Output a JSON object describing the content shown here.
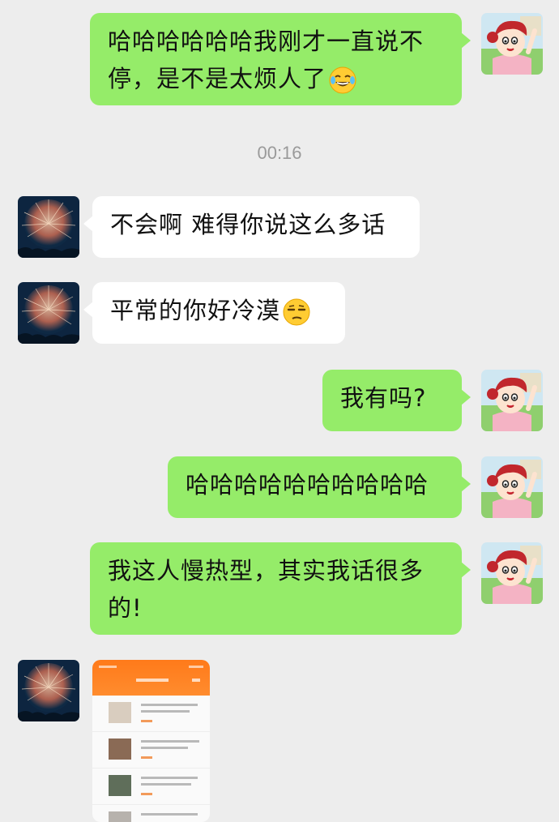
{
  "chat": {
    "timestamp": "00:16",
    "messages": [
      {
        "sender": "me",
        "text": "哈哈哈哈哈哈我刚才一直说不停，是不是太烦人了",
        "emoji": "tears-of-joy-emoji"
      },
      {
        "sender": "other",
        "text": "不会啊 难得你说这么多话"
      },
      {
        "sender": "other",
        "text": "平常的你好冷漠",
        "emoji": "unamused-face-emoji"
      },
      {
        "sender": "me",
        "text": "我有吗?"
      },
      {
        "sender": "me",
        "text": "哈哈哈哈哈哈哈哈哈哈"
      },
      {
        "sender": "me",
        "text": "我这人慢热型，其实我话很多的!"
      },
      {
        "sender": "other",
        "type": "image",
        "image": "app-screenshot-thumbnail"
      }
    ]
  },
  "avatars": {
    "me": "cartoon-girl-avatar",
    "other": "fireworks-avatar"
  },
  "colors": {
    "background": "#ededed",
    "my_bubble": "#95ec69",
    "their_bubble": "#ffffff",
    "timestamp_text": "#9a9a9a"
  }
}
